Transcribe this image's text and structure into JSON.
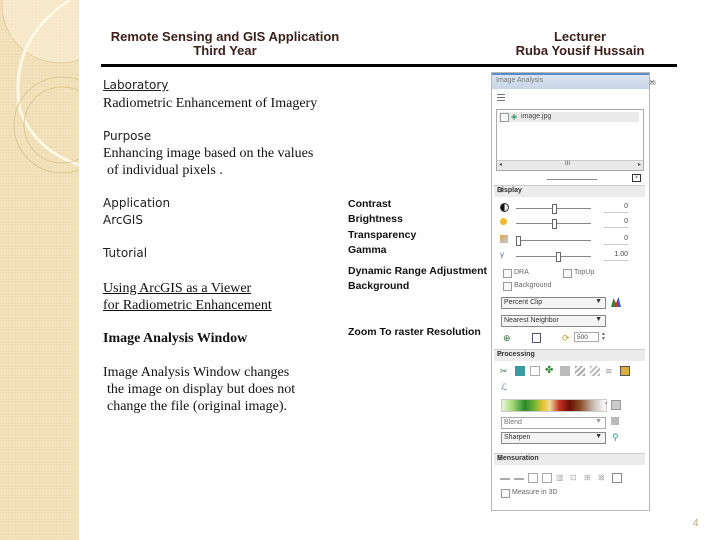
{
  "header": {
    "course_title": "Remote Sensing and GIS Application",
    "year": "Third Year",
    "lecturer_label": "Lecturer",
    "lecturer_name": "Ruba Yousif Hussain"
  },
  "content": {
    "laboratory_label": "Laboratory",
    "laboratory_title": "Radiometric Enhancement of Imagery",
    "purpose_label": "Purpose",
    "purpose_line1": "Enhancing image based on the values",
    "purpose_line2": "of individual pixels .",
    "application_label": "Application",
    "application_value": "ArcGIS",
    "tutorial_label": "Tutorial",
    "tutorial_line1": "Using ArcGIS as a Viewer",
    "tutorial_line2": "for Radiometric Enhancement",
    "window_heading": "Image Analysis Window",
    "desc_line1": "Image Analysis Window changes",
    "desc_line2": "the image on display but does not",
    "desc_line3": "change the file (original image)."
  },
  "callouts": {
    "contrast": "Contrast",
    "brightness": "Brightness",
    "transparency": "Transparency",
    "gamma": "Gamma",
    "dra": "Dynamic Range Adjustment",
    "background": "Background",
    "zoom_raster": "Zoom To raster Resolution"
  },
  "panel": {
    "title": "Image Analysis",
    "layer": "image.jpg",
    "display_label": "Display",
    "contrast_value": "0",
    "brightness_value": "0",
    "transparency_value": "0",
    "gamma_value": "1.00",
    "contrast_level": 0.5,
    "brightness_level": 0.5,
    "transparency_level": 0.0,
    "gamma_level": 0.55,
    "dra_label": "DRA",
    "topup_label": "TopUp",
    "background_label": "Background",
    "stretch_option": "Percent Clip",
    "resample_option": "Nearest Neighbor",
    "scale_value": "500",
    "processing_label": "Processing",
    "blend_option": "Blend",
    "filter_option": "Sharpen",
    "mensuration_label": "Mensuration",
    "measure3d_label": "Measure in 3D"
  },
  "page_number": "4"
}
